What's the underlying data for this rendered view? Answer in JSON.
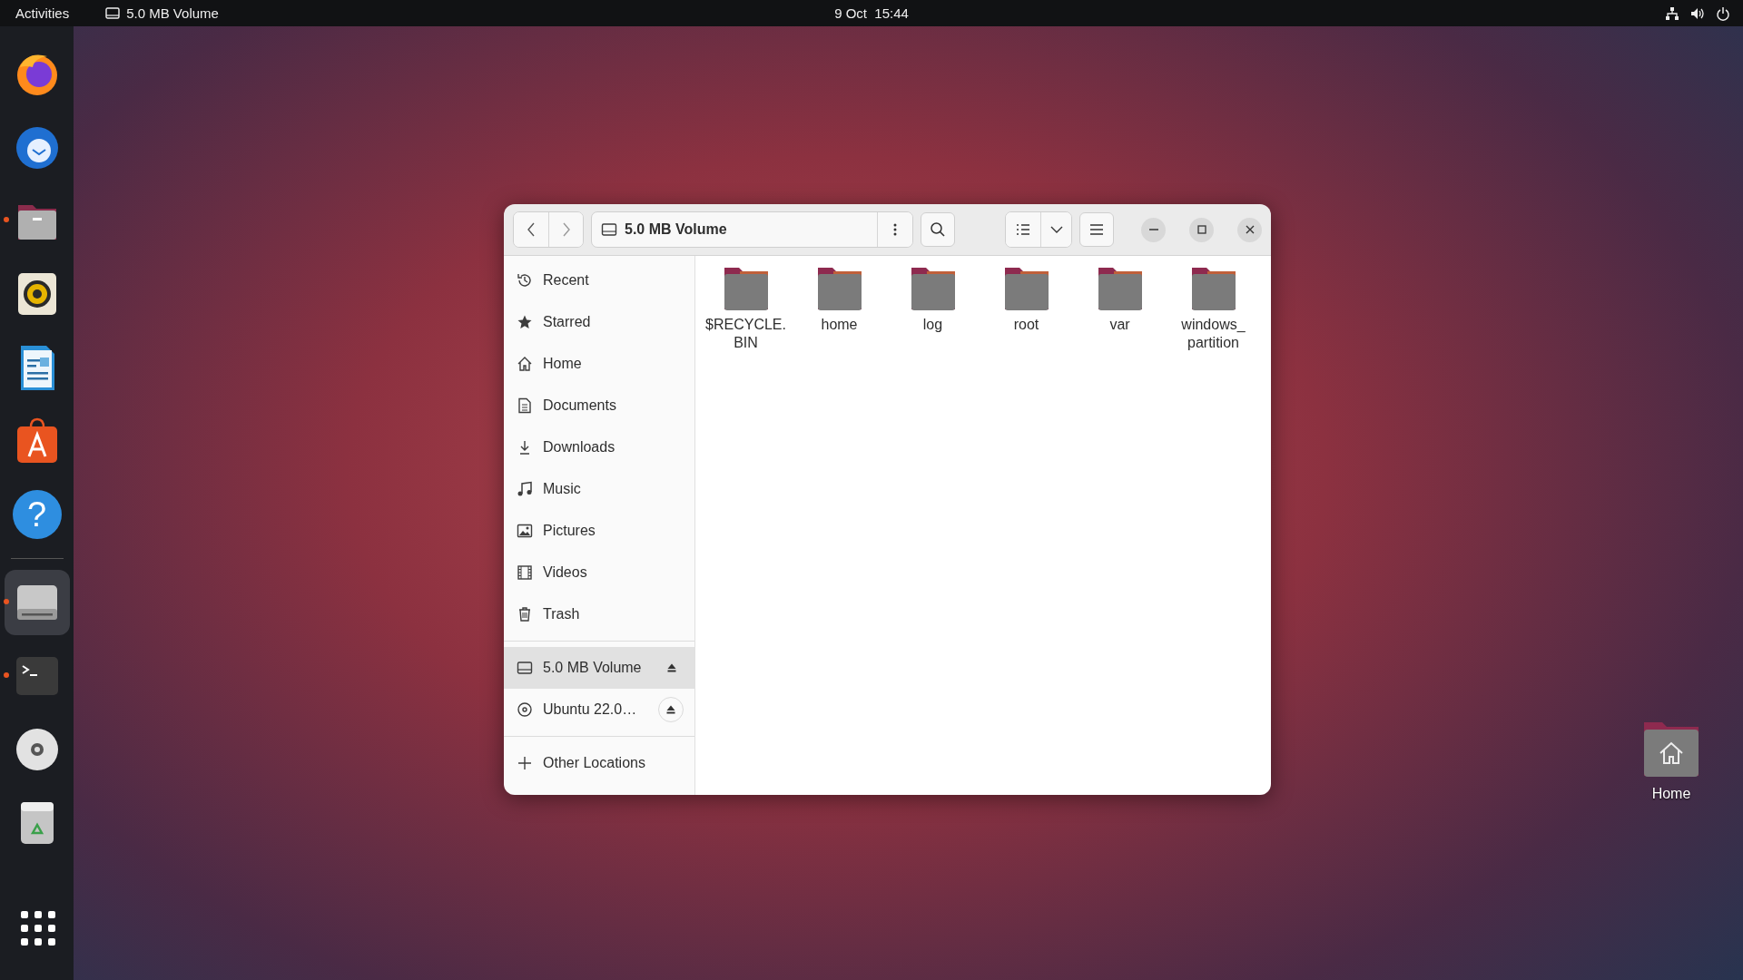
{
  "top_bar": {
    "activities": "Activities",
    "app_title": "5.0 MB Volume",
    "clock": "9 Oct  15:44"
  },
  "dock": {
    "items": [
      {
        "kind": "firefox",
        "running": false,
        "focused": false
      },
      {
        "kind": "thunderbird",
        "running": false,
        "focused": false
      },
      {
        "kind": "files",
        "running": true,
        "focused": false
      },
      {
        "kind": "rhythmbox",
        "running": false,
        "focused": false
      },
      {
        "kind": "writer",
        "running": false,
        "focused": false
      },
      {
        "kind": "appstore",
        "running": false,
        "focused": false
      },
      {
        "kind": "help",
        "running": false,
        "focused": false,
        "glyph": "?"
      },
      {
        "kind": "separator"
      },
      {
        "kind": "drive",
        "running": true,
        "focused": true
      },
      {
        "kind": "terminal",
        "running": true,
        "focused": false
      },
      {
        "kind": "disc",
        "running": false,
        "focused": false
      },
      {
        "kind": "trash",
        "running": false,
        "focused": false
      },
      {
        "kind": "apps",
        "running": false,
        "focused": false
      }
    ]
  },
  "window": {
    "location": "5.0 MB Volume",
    "sidebar": {
      "places": [
        {
          "kind": "recent",
          "label": "Recent",
          "selected": false
        },
        {
          "kind": "star",
          "label": "Starred",
          "selected": false
        },
        {
          "kind": "home",
          "label": "Home",
          "selected": false
        },
        {
          "kind": "document",
          "label": "Documents",
          "selected": false
        },
        {
          "kind": "download",
          "label": "Downloads",
          "selected": false
        },
        {
          "kind": "music",
          "label": "Music",
          "selected": false
        },
        {
          "kind": "picture",
          "label": "Pictures",
          "selected": false
        },
        {
          "kind": "video",
          "label": "Videos",
          "selected": false
        },
        {
          "kind": "trash",
          "label": "Trash",
          "selected": false
        }
      ],
      "devices": [
        {
          "kind": "drive",
          "label": "5.0 MB Volume",
          "selected": true,
          "eject": true
        },
        {
          "kind": "disc",
          "label": "Ubuntu 22.0…",
          "selected": false,
          "eject": true
        }
      ],
      "other": [
        {
          "kind": "plus",
          "label": "Other Locations",
          "selected": false
        }
      ]
    },
    "files": [
      {
        "name": "$RECYCLE.BIN"
      },
      {
        "name": "home"
      },
      {
        "name": "log"
      },
      {
        "name": "root"
      },
      {
        "name": "var"
      },
      {
        "name": "windows_partition"
      }
    ]
  },
  "desktop_icons": [
    {
      "kind": "home-folder",
      "label": "Home"
    }
  ]
}
